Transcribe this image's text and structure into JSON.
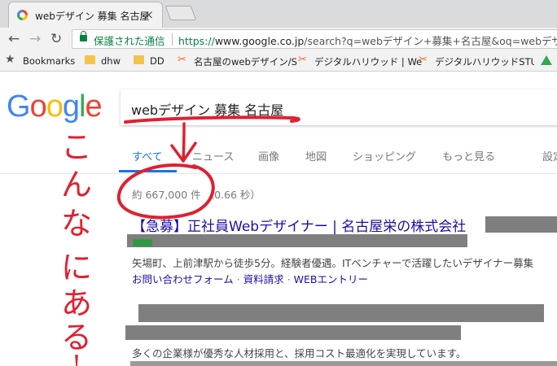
{
  "browser": {
    "tab_title": "webデザイン 募集 名古屋",
    "tab_close": "×",
    "back_glyph": "←",
    "forward_glyph": "→",
    "reload_glyph": "↻",
    "secure_label": "保護された通信",
    "url_prefix": "https://",
    "url_host": "www.google.co.jp",
    "url_rest": "/search?q=webデザイン+募集+名古屋&oq=webデザイン",
    "lock_color": "#0b8043"
  },
  "bookmarks": {
    "star_glyph": "★",
    "items": [
      {
        "label": "Bookmarks",
        "icon": "star-icon"
      },
      {
        "label": "dhw",
        "icon": "folder-icon"
      },
      {
        "label": "DD",
        "icon": "folder-icon"
      },
      {
        "label": "名古屋のwebデザイン/S",
        "icon": "digital-hollywood-icon"
      },
      {
        "label": "デジタルハリウッド | We",
        "icon": "digital-hollywood-icon"
      },
      {
        "label": "デジタルハリウッドSTUDIO",
        "icon": "digital-hollywood-icon"
      }
    ]
  },
  "google": {
    "logo_letters": [
      {
        "ch": "G",
        "color": "#4285f4"
      },
      {
        "ch": "o",
        "color": "#ea4335"
      },
      {
        "ch": "o",
        "color": "#fbbc05"
      },
      {
        "ch": "g",
        "color": "#4285f4"
      },
      {
        "ch": "l",
        "color": "#34a853"
      },
      {
        "ch": "e",
        "color": "#ea4335"
      }
    ],
    "query": "webデザイン 募集 名古屋",
    "tabs": [
      "すべて",
      "ニュース",
      "画像",
      "地図",
      "ショッピング",
      "もっと見る",
      "設定"
    ],
    "active_tab": "すべて",
    "stats": "約 667,000 件 （0.66 秒）",
    "accent_color": "#1a73e8"
  },
  "results": [
    {
      "title": "【急募】正社員Webデザイナー | 名古屋栄の株式会社",
      "snippet": "矢場町、上前津駅から徒歩5分。経験者優遇。ITベンチャーで活躍したいデザイナー募集",
      "sitelinks": [
        "お問い合わせフォーム",
        "資料請求",
        "WEBエントリー"
      ]
    },
    {
      "snippet": "多くの企業様が優秀な人材採用と、採用コスト最適化を実現しています。"
    }
  ],
  "annotation": {
    "text": [
      "こ",
      "ん",
      "な",
      "に",
      "あ",
      "る",
      "!"
    ],
    "color": "#e02030"
  }
}
